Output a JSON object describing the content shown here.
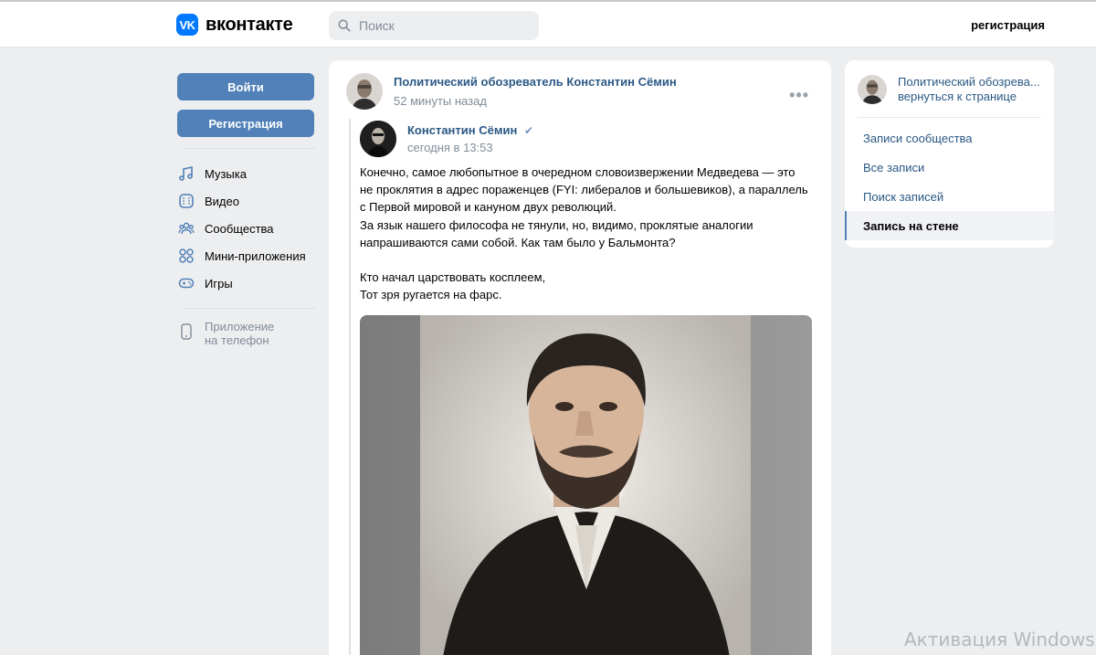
{
  "header": {
    "logo_mark": "VK",
    "logo_text": "вконтакте",
    "search_placeholder": "Поиск",
    "register_link": "регистрация"
  },
  "sidebar": {
    "login_button": "Войти",
    "register_button": "Регистрация",
    "items": [
      {
        "label": "Музыка",
        "icon": "music-icon"
      },
      {
        "label": "Видео",
        "icon": "video-icon"
      },
      {
        "label": "Сообщества",
        "icon": "communities-icon"
      },
      {
        "label": "Мини-приложения",
        "icon": "mini-apps-icon"
      },
      {
        "label": "Игры",
        "icon": "games-icon"
      }
    ],
    "phone_app_line1": "Приложение",
    "phone_app_line2": "на телефон"
  },
  "post": {
    "author": "Политический обозреватель Константин Сёмин",
    "time": "52 минуты назад",
    "more": "•••",
    "repost": {
      "author": "Константин Сёмин",
      "verified": "✔",
      "time": "сегодня в 13:53",
      "text": "Конечно, самое любопытное в очередном словоизвержении Медведева — это\nне проклятия в адрес пораженцев (FYI: либералов и большевиков), а параллель\nс Первой мировой и кануном двух революций.\nЗа язык нашего философа не тянули, но, видимо, проклятые аналогии\nнапрашиваются сами собой. Как там было у Бальмонта?\n\nКто начал царствовать косплеем,\nТот зря ругается на фарс."
    }
  },
  "right_panel": {
    "title": "Политический обозрева...",
    "subtitle": "вернуться к странице",
    "menu": [
      {
        "label": "Записи сообщества",
        "active": false
      },
      {
        "label": "Все записи",
        "active": false
      },
      {
        "label": "Поиск записей",
        "active": false
      },
      {
        "label": "Запись на стене",
        "active": true
      }
    ]
  },
  "watermark": "Активация Windows",
  "colors": {
    "accent": "#5181b8",
    "link": "#2a5885",
    "background": "#edeef0",
    "vk_blue": "#0077ff"
  }
}
